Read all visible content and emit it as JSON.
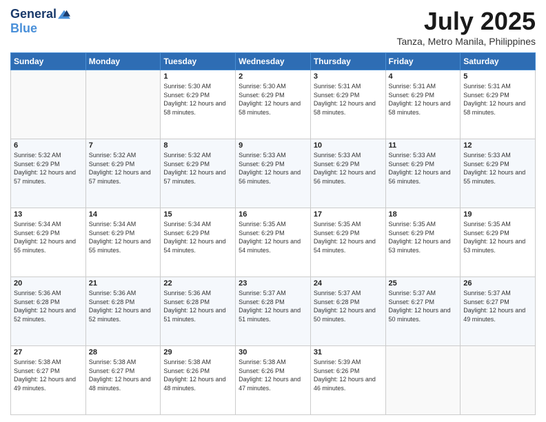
{
  "logo": {
    "general": "General",
    "blue": "Blue"
  },
  "header": {
    "month": "July 2025",
    "location": "Tanza, Metro Manila, Philippines"
  },
  "weekdays": [
    "Sunday",
    "Monday",
    "Tuesday",
    "Wednesday",
    "Thursday",
    "Friday",
    "Saturday"
  ],
  "weeks": [
    [
      {
        "day": "",
        "sunrise": "",
        "sunset": "",
        "daylight": ""
      },
      {
        "day": "",
        "sunrise": "",
        "sunset": "",
        "daylight": ""
      },
      {
        "day": "1",
        "sunrise": "Sunrise: 5:30 AM",
        "sunset": "Sunset: 6:29 PM",
        "daylight": "Daylight: 12 hours and 58 minutes."
      },
      {
        "day": "2",
        "sunrise": "Sunrise: 5:30 AM",
        "sunset": "Sunset: 6:29 PM",
        "daylight": "Daylight: 12 hours and 58 minutes."
      },
      {
        "day": "3",
        "sunrise": "Sunrise: 5:31 AM",
        "sunset": "Sunset: 6:29 PM",
        "daylight": "Daylight: 12 hours and 58 minutes."
      },
      {
        "day": "4",
        "sunrise": "Sunrise: 5:31 AM",
        "sunset": "Sunset: 6:29 PM",
        "daylight": "Daylight: 12 hours and 58 minutes."
      },
      {
        "day": "5",
        "sunrise": "Sunrise: 5:31 AM",
        "sunset": "Sunset: 6:29 PM",
        "daylight": "Daylight: 12 hours and 58 minutes."
      }
    ],
    [
      {
        "day": "6",
        "sunrise": "Sunrise: 5:32 AM",
        "sunset": "Sunset: 6:29 PM",
        "daylight": "Daylight: 12 hours and 57 minutes."
      },
      {
        "day": "7",
        "sunrise": "Sunrise: 5:32 AM",
        "sunset": "Sunset: 6:29 PM",
        "daylight": "Daylight: 12 hours and 57 minutes."
      },
      {
        "day": "8",
        "sunrise": "Sunrise: 5:32 AM",
        "sunset": "Sunset: 6:29 PM",
        "daylight": "Daylight: 12 hours and 57 minutes."
      },
      {
        "day": "9",
        "sunrise": "Sunrise: 5:33 AM",
        "sunset": "Sunset: 6:29 PM",
        "daylight": "Daylight: 12 hours and 56 minutes."
      },
      {
        "day": "10",
        "sunrise": "Sunrise: 5:33 AM",
        "sunset": "Sunset: 6:29 PM",
        "daylight": "Daylight: 12 hours and 56 minutes."
      },
      {
        "day": "11",
        "sunrise": "Sunrise: 5:33 AM",
        "sunset": "Sunset: 6:29 PM",
        "daylight": "Daylight: 12 hours and 56 minutes."
      },
      {
        "day": "12",
        "sunrise": "Sunrise: 5:33 AM",
        "sunset": "Sunset: 6:29 PM",
        "daylight": "Daylight: 12 hours and 55 minutes."
      }
    ],
    [
      {
        "day": "13",
        "sunrise": "Sunrise: 5:34 AM",
        "sunset": "Sunset: 6:29 PM",
        "daylight": "Daylight: 12 hours and 55 minutes."
      },
      {
        "day": "14",
        "sunrise": "Sunrise: 5:34 AM",
        "sunset": "Sunset: 6:29 PM",
        "daylight": "Daylight: 12 hours and 55 minutes."
      },
      {
        "day": "15",
        "sunrise": "Sunrise: 5:34 AM",
        "sunset": "Sunset: 6:29 PM",
        "daylight": "Daylight: 12 hours and 54 minutes."
      },
      {
        "day": "16",
        "sunrise": "Sunrise: 5:35 AM",
        "sunset": "Sunset: 6:29 PM",
        "daylight": "Daylight: 12 hours and 54 minutes."
      },
      {
        "day": "17",
        "sunrise": "Sunrise: 5:35 AM",
        "sunset": "Sunset: 6:29 PM",
        "daylight": "Daylight: 12 hours and 54 minutes."
      },
      {
        "day": "18",
        "sunrise": "Sunrise: 5:35 AM",
        "sunset": "Sunset: 6:29 PM",
        "daylight": "Daylight: 12 hours and 53 minutes."
      },
      {
        "day": "19",
        "sunrise": "Sunrise: 5:35 AM",
        "sunset": "Sunset: 6:29 PM",
        "daylight": "Daylight: 12 hours and 53 minutes."
      }
    ],
    [
      {
        "day": "20",
        "sunrise": "Sunrise: 5:36 AM",
        "sunset": "Sunset: 6:28 PM",
        "daylight": "Daylight: 12 hours and 52 minutes."
      },
      {
        "day": "21",
        "sunrise": "Sunrise: 5:36 AM",
        "sunset": "Sunset: 6:28 PM",
        "daylight": "Daylight: 12 hours and 52 minutes."
      },
      {
        "day": "22",
        "sunrise": "Sunrise: 5:36 AM",
        "sunset": "Sunset: 6:28 PM",
        "daylight": "Daylight: 12 hours and 51 minutes."
      },
      {
        "day": "23",
        "sunrise": "Sunrise: 5:37 AM",
        "sunset": "Sunset: 6:28 PM",
        "daylight": "Daylight: 12 hours and 51 minutes."
      },
      {
        "day": "24",
        "sunrise": "Sunrise: 5:37 AM",
        "sunset": "Sunset: 6:28 PM",
        "daylight": "Daylight: 12 hours and 50 minutes."
      },
      {
        "day": "25",
        "sunrise": "Sunrise: 5:37 AM",
        "sunset": "Sunset: 6:27 PM",
        "daylight": "Daylight: 12 hours and 50 minutes."
      },
      {
        "day": "26",
        "sunrise": "Sunrise: 5:37 AM",
        "sunset": "Sunset: 6:27 PM",
        "daylight": "Daylight: 12 hours and 49 minutes."
      }
    ],
    [
      {
        "day": "27",
        "sunrise": "Sunrise: 5:38 AM",
        "sunset": "Sunset: 6:27 PM",
        "daylight": "Daylight: 12 hours and 49 minutes."
      },
      {
        "day": "28",
        "sunrise": "Sunrise: 5:38 AM",
        "sunset": "Sunset: 6:27 PM",
        "daylight": "Daylight: 12 hours and 48 minutes."
      },
      {
        "day": "29",
        "sunrise": "Sunrise: 5:38 AM",
        "sunset": "Sunset: 6:26 PM",
        "daylight": "Daylight: 12 hours and 48 minutes."
      },
      {
        "day": "30",
        "sunrise": "Sunrise: 5:38 AM",
        "sunset": "Sunset: 6:26 PM",
        "daylight": "Daylight: 12 hours and 47 minutes."
      },
      {
        "day": "31",
        "sunrise": "Sunrise: 5:39 AM",
        "sunset": "Sunset: 6:26 PM",
        "daylight": "Daylight: 12 hours and 46 minutes."
      },
      {
        "day": "",
        "sunrise": "",
        "sunset": "",
        "daylight": ""
      },
      {
        "day": "",
        "sunrise": "",
        "sunset": "",
        "daylight": ""
      }
    ]
  ]
}
